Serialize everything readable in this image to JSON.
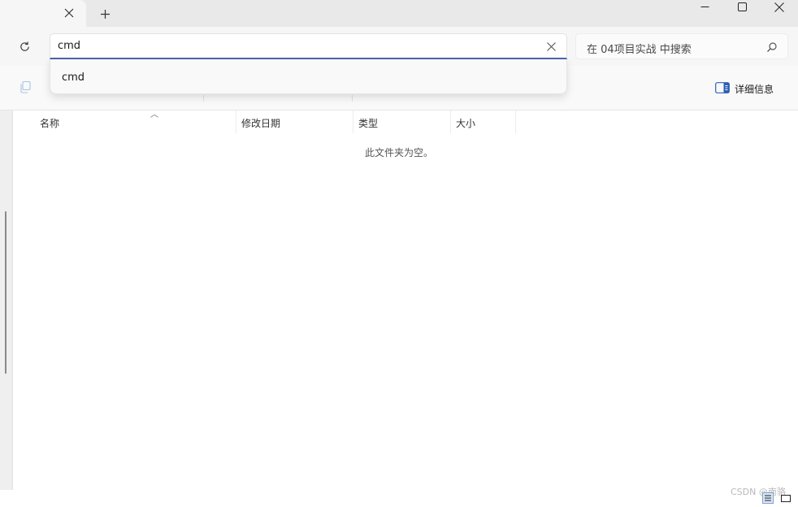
{
  "address": {
    "path_value": "cmd",
    "search_placeholder": "在 04项目实战 中搜索"
  },
  "suggestion": {
    "items": [
      "cmd"
    ]
  },
  "toolbar": {
    "details_label": "详细信息"
  },
  "columns": [
    "名称",
    "修改日期",
    "类型",
    "大小"
  ],
  "empty_message": "此文件夹为空。",
  "watermark": "CSDN @南骆",
  "colors": {
    "accent": "#4d61b4",
    "details_icon": "#2c5fb3"
  }
}
